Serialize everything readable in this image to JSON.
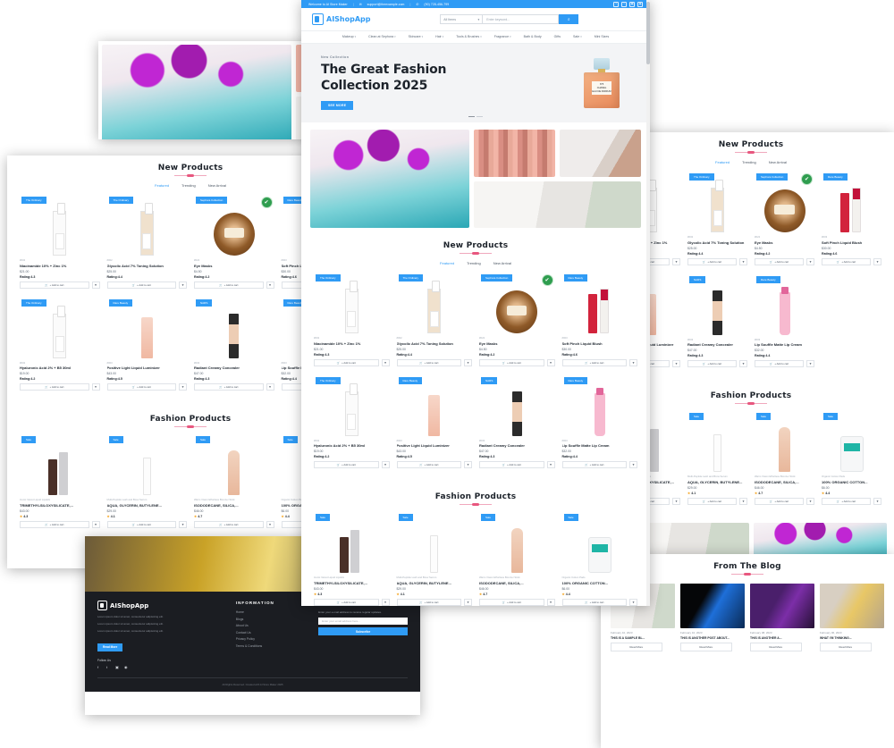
{
  "brand": {
    "name": "AIShopApp",
    "color": "#2f9bf5"
  },
  "topbar": {
    "welcome": "Welcome to AI Store Maker",
    "email": "support@theexample.com",
    "phone": "(90) 728-456-799",
    "socials": [
      "f",
      "t",
      "in",
      "g"
    ]
  },
  "search": {
    "category_selected": "All Items",
    "placeholder": "Enter keyword...",
    "button_icon": "search-icon"
  },
  "nav": [
    "Makeup",
    "Clean at Sephora",
    "Skincare",
    "Hair",
    "Tools & Brushes",
    "Fragrance",
    "Bath & Body",
    "Gifts",
    "Sale",
    "Mini Sizes"
  ],
  "hero": {
    "eyebrow": "New Collection",
    "title_line1": "The Great Fashion",
    "title_line2": "Collection 2025",
    "cta": "SEE MORE",
    "product_label_line1": "N°5",
    "product_label_line2": "CHANEL",
    "product_label_line3": "EAU DE PARFUM"
  },
  "categories": [
    {
      "name": "makeup-brushes",
      "class": "img-brushes"
    },
    {
      "name": "eyeshadow-palette",
      "class": "img-palette"
    },
    {
      "name": "cosmetics-flatlay",
      "class": "img-flatlay"
    },
    {
      "name": "skincare-bottles",
      "class": "img-bottles"
    }
  ],
  "new_products": {
    "title": "New Products",
    "tabs": [
      {
        "label": "Featured",
        "active": true
      },
      {
        "label": "Trending",
        "active": false
      },
      {
        "label": "New Arrival",
        "active": false
      }
    ],
    "add_to_cart": "+ Add to cart",
    "items": [
      {
        "badge": "The Ordinary",
        "sku": "#002",
        "name": "Niacinamide 10% + Zinc 1%",
        "price": "$21.00",
        "rating": "Rating:4.3",
        "shape": "sh-dropper",
        "eco": false
      },
      {
        "badge": "The Ordinary",
        "sku": "#002",
        "name": "Glycolic Acid 7% Toning Solution",
        "price": "$25.00",
        "rating": "Rating:4.4",
        "shape": "sh-dropper tan",
        "eco": false
      },
      {
        "badge": "Sephora Collection",
        "sku": "#022",
        "name": "Eye Masks",
        "price": "$4.50",
        "rating": "Rating:4.2",
        "shape": "sh-choco",
        "eco": true
      },
      {
        "badge": "Rare Beauty",
        "sku": "#003",
        "name": "Soft Pinch Liquid Blush",
        "price": "$30.00",
        "rating": "Rating:4.6",
        "shape": "sh-lipduo",
        "eco": false
      },
      {
        "badge": "The Ordinary",
        "sku": "#002",
        "name": "Hyaluronic Acid 2% + B5 30ml",
        "price": "$19.00",
        "rating": "Rating:4.2",
        "shape": "sh-serum",
        "eco": false
      },
      {
        "badge": "Rare Beauty",
        "sku": "#003",
        "name": "Positive Light Liquid Luminizer",
        "price": "$43.00",
        "rating": "Rating:4.5",
        "shape": "sh-tube",
        "eco": false
      },
      {
        "badge": "NARS",
        "sku": "#003",
        "name": "Radiant Creamy Concealer",
        "price": "$47.00",
        "rating": "Rating:4.3",
        "shape": "sh-conceal",
        "eco": false
      },
      {
        "badge": "Rare Beauty",
        "sku": "#003",
        "name": "Lip Souffle Matte Lip Cream",
        "price": "$32.00",
        "rating": "Rating:4.4",
        "shape": "sh-lipgloss",
        "eco": false
      }
    ]
  },
  "fashion_products": {
    "title": "Fashion Products",
    "badge": "Sale",
    "add_to_cart": "+ Add to cart",
    "items": [
      {
        "brand": "Iconic Velvet Liquid Lipstick",
        "name": "TRIMETHYLSILOXYSILICATE,...",
        "price": "$43.00",
        "rating": "4.3",
        "shape": "sh-glosspair"
      },
      {
        "brand": "Multi-Peptide Lash and Brow Serum",
        "name": "AQUA, GLYCERIN, BUTYLENE...",
        "price": "$29.00",
        "rating": "4.1",
        "shape": "sh-serum"
      },
      {
        "brand": "Warm Vision Effortless Bronzer Stick",
        "name": "ISODODECANE, SILICA,...",
        "price": "$46.00",
        "rating": "4.7",
        "shape": "sh-stick"
      },
      {
        "brand": "Organic Cotton Pads",
        "name": "100% ORGANIC COTTON...",
        "price": "$6.00",
        "rating": "4.4",
        "shape": "sh-pads"
      }
    ]
  },
  "blog": {
    "title": "From The Blog",
    "read_more": "Read More",
    "items": [
      {
        "date": "February 10, 2023",
        "title": "THIS IS A SAMPLE BL...",
        "class": "img-bottles"
      },
      {
        "date": "February 10, 2023",
        "title": "THIS IS ANOTHER POST ABOUT...",
        "class": "img-laptop"
      },
      {
        "date": "February 08, 2023",
        "title": "THIS IS ANOTHER A...",
        "class": "img-tv"
      },
      {
        "date": "February 06, 2023",
        "title": "WHAT I'M THINKING...",
        "class": "img-food"
      }
    ]
  },
  "footer": {
    "brand": "AIShopApp",
    "about_paragraphs": [
      "Lorem ipsum dolor sit amet, consectetur adipisicing elit.",
      "Lorem ipsum dolor sit amet, consectetur adipisicing elit.",
      "Lorem ipsum dolor sit amet, consectetur adipisicing elit."
    ],
    "read_more": "Read More",
    "information_title": "INFORMATION",
    "information_links": [
      "Home",
      "Blogs",
      "About Us",
      "Contact Us",
      "Privacy Policy",
      "Terms & Conditions"
    ],
    "newsletter_title": "NEWSLETTER",
    "newsletter_hint": "Enter your e-mail address to receive regular updates.",
    "newsletter_placeholder": "Enter your email address here...",
    "subscribe": "Subscribe",
    "follow_us": "Follow Us",
    "socials": [
      "f",
      "t",
      "in",
      "g"
    ],
    "copyright": "All Rights Reserved. Created with AI Store Maker 2025"
  }
}
